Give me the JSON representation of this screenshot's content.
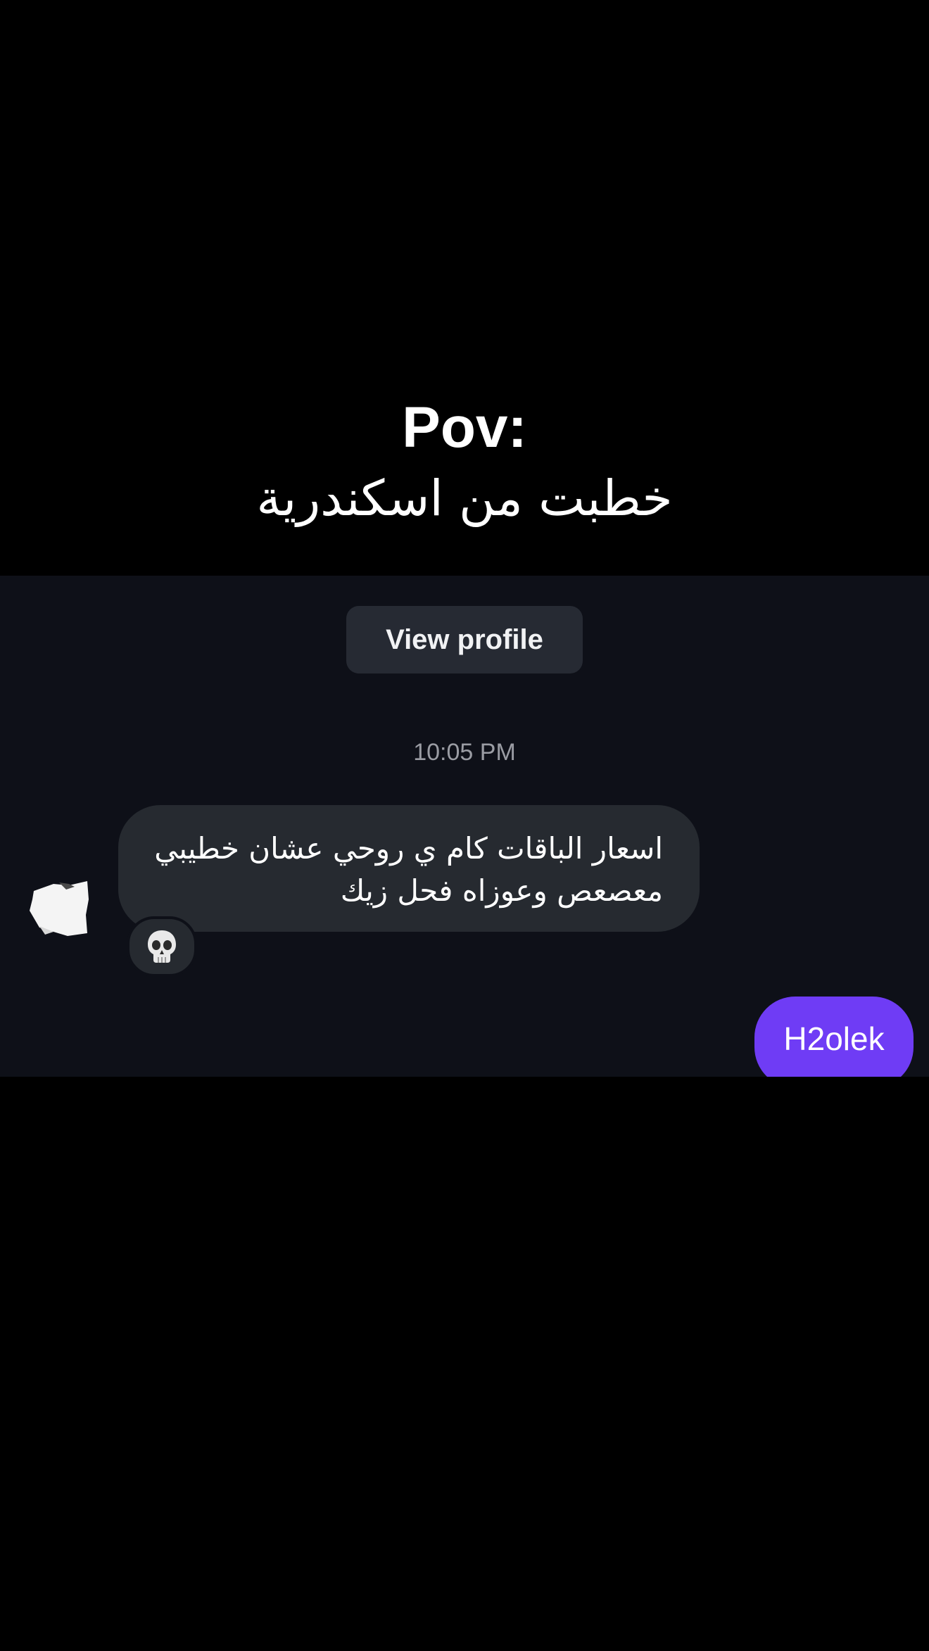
{
  "caption": {
    "line1": "Pov:",
    "line2": "خطبت من اسكندرية"
  },
  "chat": {
    "view_profile_label": "View profile",
    "timestamp": "10:05 PM",
    "incoming_message": {
      "line1": "اسعار الباقات كام ي روحي عشان خطيبي",
      "line2": "معصعص وعوزاه فحل زيك",
      "reaction_icon": "skull-emoji"
    },
    "outgoing_message": {
      "text": "H2olek"
    }
  },
  "colors": {
    "page_background": "#000000",
    "chat_background": "#0e1018",
    "incoming_bubble": "#262a30",
    "outgoing_bubble": "#6f3cf5",
    "button_background": "#262a33",
    "timestamp_text": "#9a9ca3"
  }
}
